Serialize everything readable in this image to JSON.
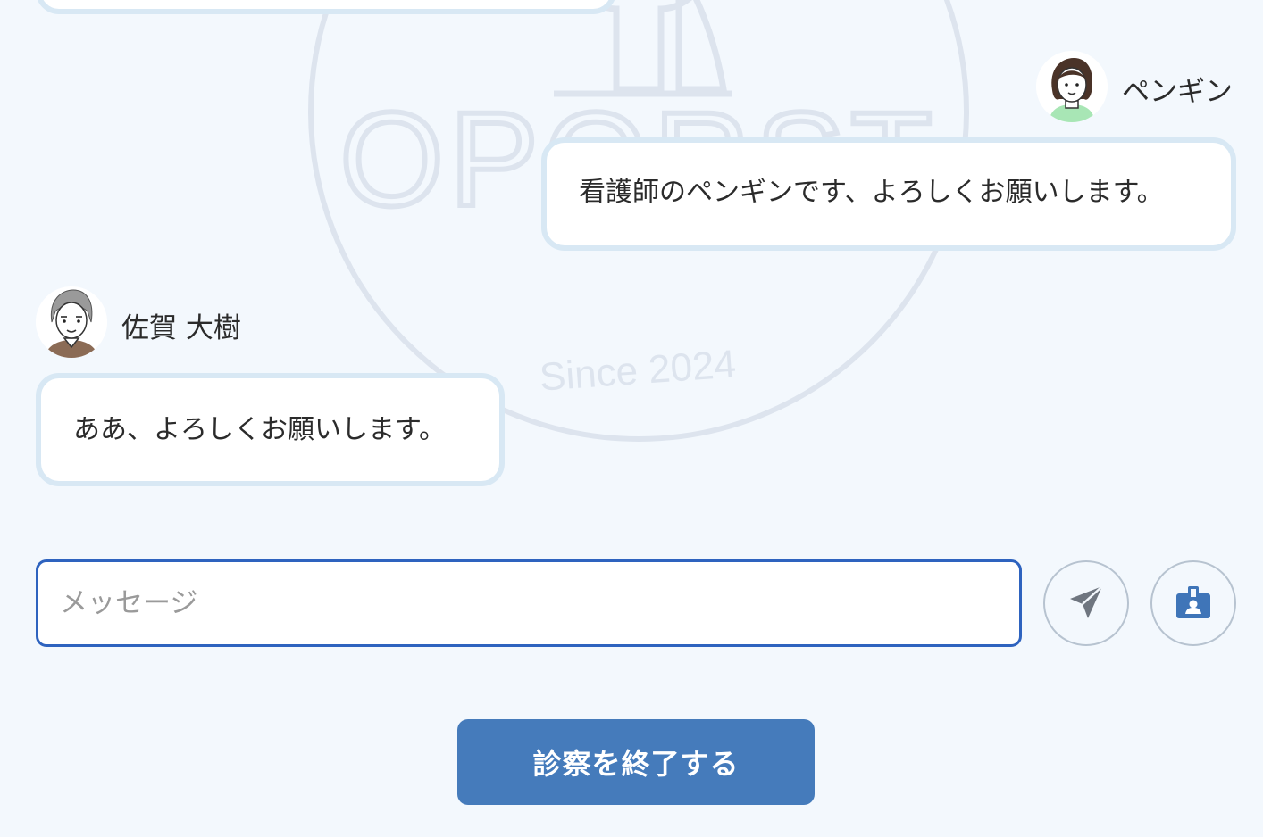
{
  "watermark": {
    "brand": "OPORST",
    "since": "Since 2024"
  },
  "conversation": {
    "messages": [
      {
        "sender": "ペンギン",
        "avatar_icon": "nurse-avatar-icon",
        "text": "看護師のペンギンです、よろしくお願いします。"
      },
      {
        "sender": "佐賀 大樹",
        "avatar_icon": "elderly-man-avatar-icon",
        "text": "ああ、よろしくお願いします。"
      }
    ]
  },
  "composer": {
    "placeholder": "メッセージ",
    "value": "",
    "send_icon": "paper-plane-icon",
    "id_icon": "id-badge-icon"
  },
  "actions": {
    "end_consultation": "診察を終了する"
  },
  "colors": {
    "page_background": "#f3f8fd",
    "bubble_border": "#d8e8f4",
    "input_border": "#2e63bf",
    "primary_button": "#457bbb",
    "icon_blue": "#3f75b8",
    "icon_gray": "#6f7680"
  }
}
